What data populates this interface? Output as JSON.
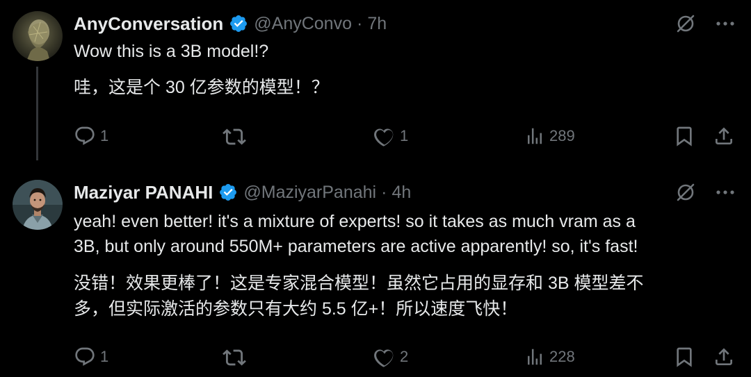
{
  "tweets": [
    {
      "name": "AnyConversation",
      "handle": "@AnyConvo",
      "separator": "·",
      "time": "7h",
      "text_en": "Wow this is a 3B model!?",
      "text_zh": "哇，这是个 30 亿参数的模型！？",
      "counts": {
        "replies": "1",
        "likes": "1",
        "views": "289"
      }
    },
    {
      "name": "Maziyar PANAHI",
      "handle": "@MaziyarPanahi",
      "separator": "·",
      "time": "4h",
      "text_en_1": "yeah! even better! it's a mixture of experts! so it takes as much vram as a",
      "text_en_2": "3B, but only around 550M+ parameters are active apparently! so, it's fast!",
      "text_zh_1": "没错！效果更棒了！这是专家混合模型！虽然它占用的显存和 3B 模型差不",
      "text_zh_2": "多，但实际激活的参数只有大约 5.5 亿+！所以速度飞快！",
      "counts": {
        "replies": "1",
        "likes": "2",
        "views": "228"
      }
    }
  ],
  "colors": {
    "background": "#000000",
    "text": "#e7e9ea",
    "muted": "#71767b",
    "verified": "#1d9bf0"
  },
  "icons": [
    "verified-badge-icon",
    "grok-icon",
    "more-icon",
    "reply-icon",
    "retweet-icon",
    "like-icon",
    "views-icon",
    "bookmark-icon",
    "share-icon"
  ]
}
